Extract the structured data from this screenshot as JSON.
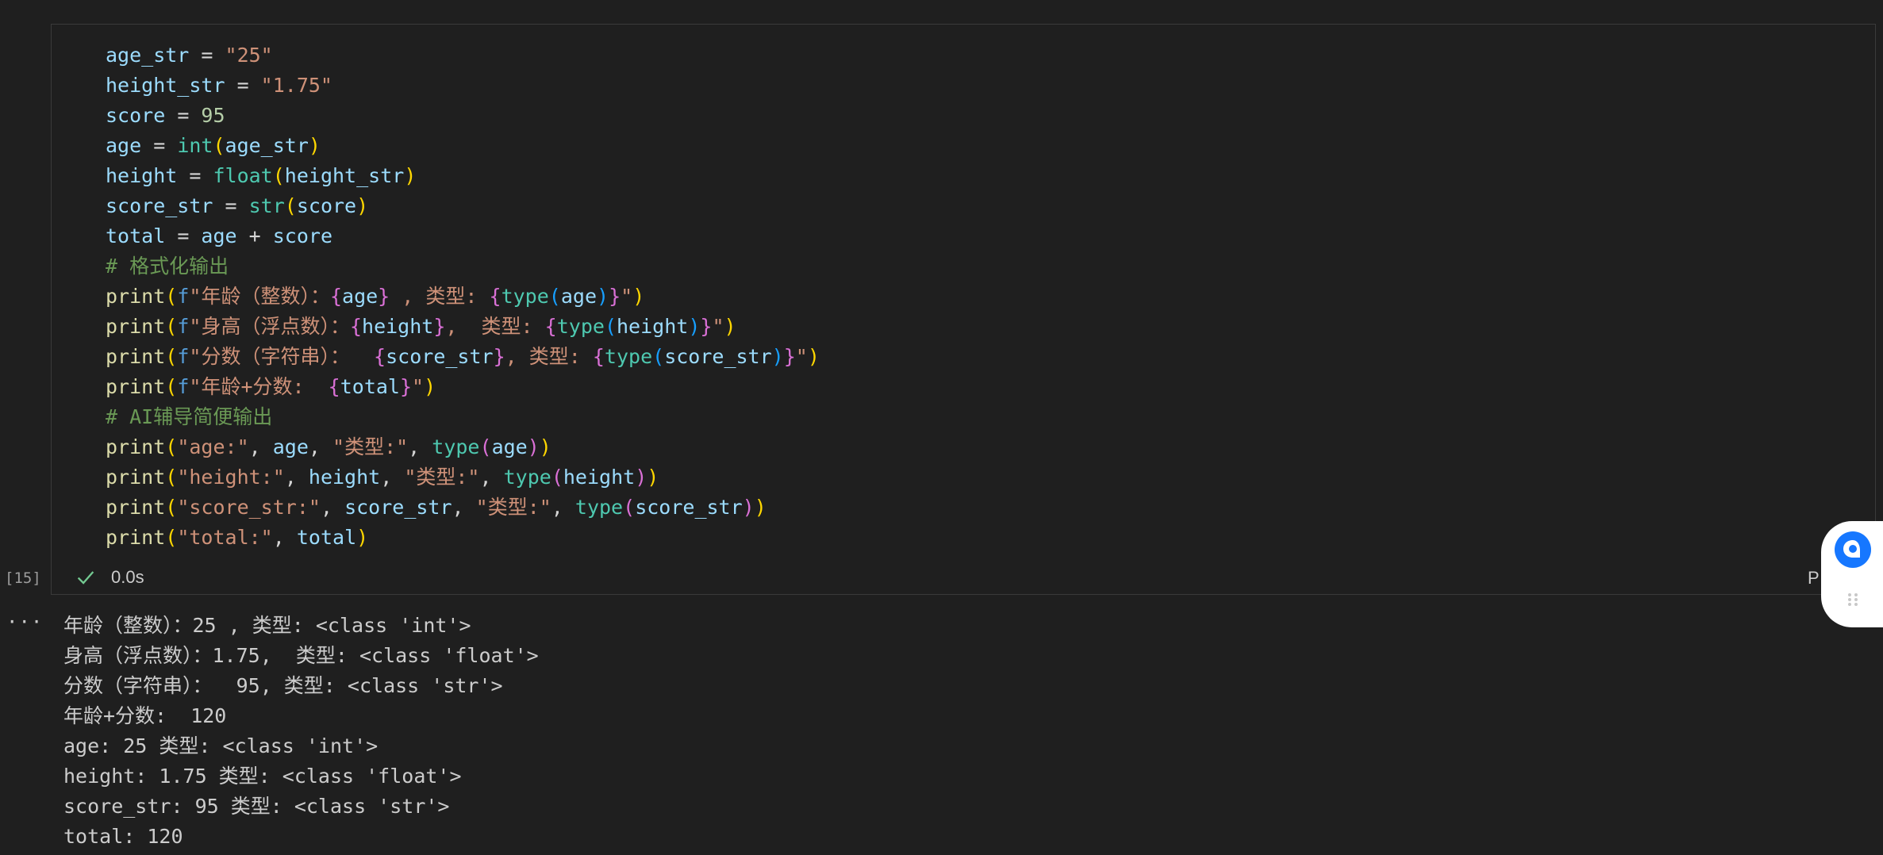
{
  "code_lines": [
    [
      [
        "v",
        "age_str"
      ],
      [
        "op",
        " = "
      ],
      [
        "str",
        "\"25\""
      ]
    ],
    [
      [
        "v",
        "height_str"
      ],
      [
        "op",
        " = "
      ],
      [
        "str",
        "\"1.75\""
      ]
    ],
    [
      [
        "v",
        "score"
      ],
      [
        "op",
        " = "
      ],
      [
        "num",
        "95"
      ]
    ],
    [
      [
        "v",
        "age"
      ],
      [
        "op",
        " = "
      ],
      [
        "bi",
        "int"
      ],
      [
        "br1",
        "("
      ],
      [
        "v",
        "age_str"
      ],
      [
        "br1",
        ")"
      ]
    ],
    [
      [
        "v",
        "height"
      ],
      [
        "op",
        " = "
      ],
      [
        "bi",
        "float"
      ],
      [
        "br1",
        "("
      ],
      [
        "v",
        "height_str"
      ],
      [
        "br1",
        ")"
      ]
    ],
    [
      [
        "v",
        "score_str"
      ],
      [
        "op",
        " = "
      ],
      [
        "bi",
        "str"
      ],
      [
        "br1",
        "("
      ],
      [
        "v",
        "score"
      ],
      [
        "br1",
        ")"
      ]
    ],
    [
      [
        "v",
        "total"
      ],
      [
        "op",
        " = "
      ],
      [
        "v",
        "age"
      ],
      [
        "op",
        " + "
      ],
      [
        "v",
        "score"
      ]
    ],
    [
      [
        "cm",
        "# 格式化输出"
      ]
    ],
    [
      [
        "fn",
        "print"
      ],
      [
        "br1",
        "("
      ],
      [
        "kw",
        "f"
      ],
      [
        "str",
        "\"年龄（整数）："
      ],
      [
        "br2",
        "{"
      ],
      [
        "v",
        "age"
      ],
      [
        "br2",
        "}"
      ],
      [
        "str",
        " , 类型: "
      ],
      [
        "br2",
        "{"
      ],
      [
        "bi",
        "type"
      ],
      [
        "br3",
        "("
      ],
      [
        "v",
        "age"
      ],
      [
        "br3",
        ")"
      ],
      [
        "br2",
        "}"
      ],
      [
        "str",
        "\""
      ],
      [
        "br1",
        ")"
      ]
    ],
    [
      [
        "fn",
        "print"
      ],
      [
        "br1",
        "("
      ],
      [
        "kw",
        "f"
      ],
      [
        "str",
        "\"身高（浮点数）："
      ],
      [
        "br2",
        "{"
      ],
      [
        "v",
        "height"
      ],
      [
        "br2",
        "}"
      ],
      [
        "str",
        ",  类型: "
      ],
      [
        "br2",
        "{"
      ],
      [
        "bi",
        "type"
      ],
      [
        "br3",
        "("
      ],
      [
        "v",
        "height"
      ],
      [
        "br3",
        ")"
      ],
      [
        "br2",
        "}"
      ],
      [
        "str",
        "\""
      ],
      [
        "br1",
        ")"
      ]
    ],
    [
      [
        "fn",
        "print"
      ],
      [
        "br1",
        "("
      ],
      [
        "kw",
        "f"
      ],
      [
        "str",
        "\"分数（字符串）：  "
      ],
      [
        "br2",
        "{"
      ],
      [
        "v",
        "score_str"
      ],
      [
        "br2",
        "}"
      ],
      [
        "str",
        ", 类型: "
      ],
      [
        "br2",
        "{"
      ],
      [
        "bi",
        "type"
      ],
      [
        "br3",
        "("
      ],
      [
        "v",
        "score_str"
      ],
      [
        "br3",
        ")"
      ],
      [
        "br2",
        "}"
      ],
      [
        "str",
        "\""
      ],
      [
        "br1",
        ")"
      ]
    ],
    [
      [
        "fn",
        "print"
      ],
      [
        "br1",
        "("
      ],
      [
        "kw",
        "f"
      ],
      [
        "str",
        "\"年龄+分数:  "
      ],
      [
        "br2",
        "{"
      ],
      [
        "v",
        "total"
      ],
      [
        "br2",
        "}"
      ],
      [
        "str",
        "\""
      ],
      [
        "br1",
        ")"
      ]
    ],
    [
      [
        "cm",
        "# AI辅导简便输出"
      ]
    ],
    [
      [
        "fn",
        "print"
      ],
      [
        "br1",
        "("
      ],
      [
        "str",
        "\"age:\""
      ],
      [
        "op",
        ", "
      ],
      [
        "v",
        "age"
      ],
      [
        "op",
        ", "
      ],
      [
        "str",
        "\"类型:\""
      ],
      [
        "op",
        ", "
      ],
      [
        "bi",
        "type"
      ],
      [
        "br2",
        "("
      ],
      [
        "v",
        "age"
      ],
      [
        "br2",
        ")"
      ],
      [
        "br1",
        ")"
      ]
    ],
    [
      [
        "fn",
        "print"
      ],
      [
        "br1",
        "("
      ],
      [
        "str",
        "\"height:\""
      ],
      [
        "op",
        ", "
      ],
      [
        "v",
        "height"
      ],
      [
        "op",
        ", "
      ],
      [
        "str",
        "\"类型:\""
      ],
      [
        "op",
        ", "
      ],
      [
        "bi",
        "type"
      ],
      [
        "br2",
        "("
      ],
      [
        "v",
        "height"
      ],
      [
        "br2",
        ")"
      ],
      [
        "br1",
        ")"
      ]
    ],
    [
      [
        "fn",
        "print"
      ],
      [
        "br1",
        "("
      ],
      [
        "str",
        "\"score_str:\""
      ],
      [
        "op",
        ", "
      ],
      [
        "v",
        "score_str"
      ],
      [
        "op",
        ", "
      ],
      [
        "str",
        "\"类型:\""
      ],
      [
        "op",
        ", "
      ],
      [
        "bi",
        "type"
      ],
      [
        "br2",
        "("
      ],
      [
        "v",
        "score_str"
      ],
      [
        "br2",
        ")"
      ],
      [
        "br1",
        ")"
      ]
    ],
    [
      [
        "fn",
        "print"
      ],
      [
        "br1",
        "("
      ],
      [
        "str",
        "\"total:\""
      ],
      [
        "op",
        ", "
      ],
      [
        "v",
        "total"
      ],
      [
        "br1",
        ")"
      ]
    ]
  ],
  "cell": {
    "execution_count": "[15]",
    "duration": "0.0s",
    "right_label": "P"
  },
  "output_more": "···",
  "output_lines": [
    "年龄（整数）：25 , 类型: <class 'int'>",
    "身高（浮点数）：1.75,  类型: <class 'float'>",
    "分数（字符串）：  95, 类型: <class 'str'>",
    "年龄+分数:  120",
    "age: 25 类型: <class 'int'>",
    "height: 1.75 类型: <class 'float'>",
    "score_str: 95 类型: <class 'str'>",
    "total: 120"
  ],
  "icons": {
    "status": "check-icon",
    "output_menu": "more-icon",
    "assistant": "assistant-bubble-icon",
    "drag": "drag-handle-icon"
  },
  "colors": {
    "background": "#1f1f1f",
    "success": "#73c991",
    "assistant_blue": "#1677ff"
  }
}
